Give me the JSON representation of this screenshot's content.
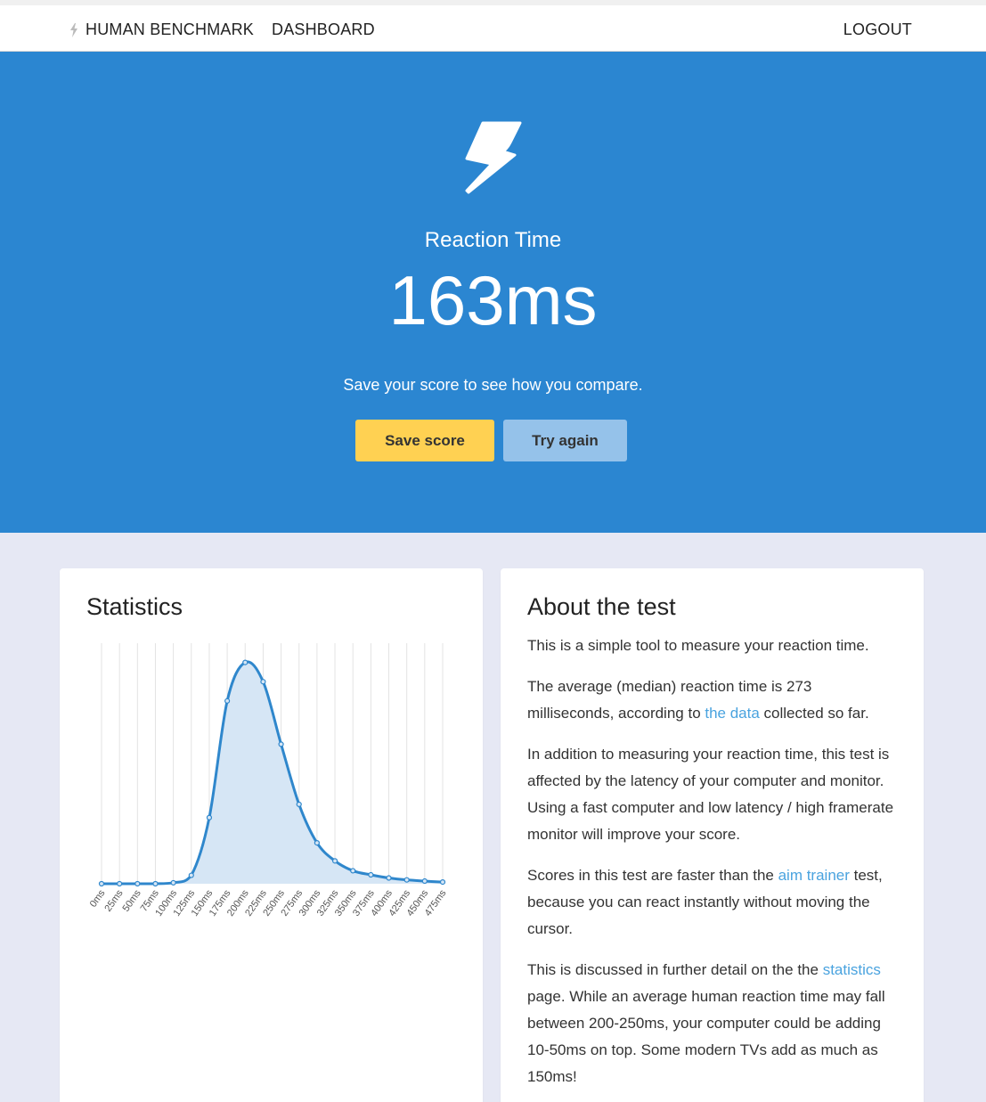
{
  "nav": {
    "brand": "HUMAN BENCHMARK",
    "dashboard": "DASHBOARD",
    "logout": "LOGOUT"
  },
  "hero": {
    "icon": "lightning-bolt",
    "title": "Reaction Time",
    "score": "163ms",
    "subtitle": "Save your score to see how you compare.",
    "save_label": "Save score",
    "try_label": "Try again",
    "colors": {
      "background": "#2b86d1",
      "save": "#ffd152",
      "try": "#95c2ea"
    }
  },
  "stats": {
    "title": "Statistics",
    "chart_data": {
      "type": "area",
      "x": [
        "0ms",
        "25ms",
        "50ms",
        "75ms",
        "100ms",
        "125ms",
        "150ms",
        "175ms",
        "200ms",
        "225ms",
        "250ms",
        "275ms",
        "300ms",
        "325ms",
        "350ms",
        "375ms",
        "400ms",
        "425ms",
        "450ms",
        "475ms"
      ],
      "y": [
        0,
        0,
        0,
        0,
        0.4,
        3.5,
        27.5,
        76,
        92,
        84,
        58,
        33,
        17,
        9.5,
        5.4,
        3.7,
        2.4,
        1.6,
        1.1,
        0.7
      ],
      "ylim": [
        0,
        100
      ],
      "grid": "vertical",
      "color": "#2f87cc",
      "fill": "#d6e6f5"
    }
  },
  "about": {
    "title": "About the test",
    "p1": "This is a simple tool to measure your reaction time.",
    "p2_a": "The average (median) reaction time is 273 milliseconds, according to ",
    "p2_link": "the data",
    "p2_b": " collected so far.",
    "p3": "In addition to measuring your reaction time, this test is affected by the latency of your computer and monitor. Using a fast computer and low latency / high framerate monitor will improve your score.",
    "p4_a": "Scores in this test are faster than the ",
    "p4_link": "aim trainer",
    "p4_b": " test, because you can react instantly without moving the cursor.",
    "p5_a": "This is discussed in further detail on the the ",
    "p5_link": "statistics",
    "p5_b": " page. While an average human reaction time may fall between 200-250ms, your computer could be adding 10-50ms on top. Some modern TVs add as much as 150ms!"
  }
}
